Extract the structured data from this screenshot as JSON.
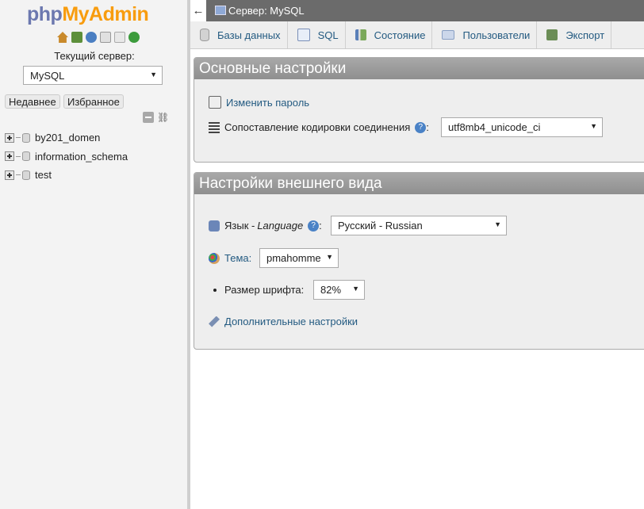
{
  "nav": {
    "logo_php": "php",
    "logo_myadmin": "MyAdmin",
    "server_label": "Текущий сервер:",
    "server_value": "MySQL",
    "tab_recent": "Недавнее",
    "tab_favorites": "Избранное",
    "databases": [
      "by201_domen",
      "information_schema",
      "test"
    ]
  },
  "topbar": {
    "back": "←",
    "breadcrumb": "Сервер: MySQL"
  },
  "menu": {
    "tabs": [
      {
        "label": "Базы данных",
        "icon": "database-icon"
      },
      {
        "label": "SQL",
        "icon": "sql-icon"
      },
      {
        "label": "Состояние",
        "icon": "status-icon"
      },
      {
        "label": "Пользователи",
        "icon": "users-icon"
      },
      {
        "label": "Экспорт",
        "icon": "export-icon"
      }
    ]
  },
  "general": {
    "title": "Основные настройки",
    "change_password": "Изменить пароль",
    "collation_label": "Сопоставление кодировки соединения",
    "collation_colon": ":",
    "collation_value": "utf8mb4_unicode_ci"
  },
  "appearance": {
    "title": "Настройки внешнего вида",
    "language_label": "Язык - ",
    "language_label_en": "Language",
    "language_colon": ":",
    "language_value": "Русский - Russian",
    "theme_label": "Тема:",
    "theme_value": "pmahomme",
    "font_label": "Размер шрифта:",
    "font_value": "82%",
    "more_settings": "Дополнительные настройки"
  },
  "colors": {
    "accent_link": "#235a81",
    "panel_header": "#9a9a9a",
    "topbar": "#6b6b6b",
    "logo_php": "#6c78af",
    "logo_myadmin": "#f89c0e"
  }
}
